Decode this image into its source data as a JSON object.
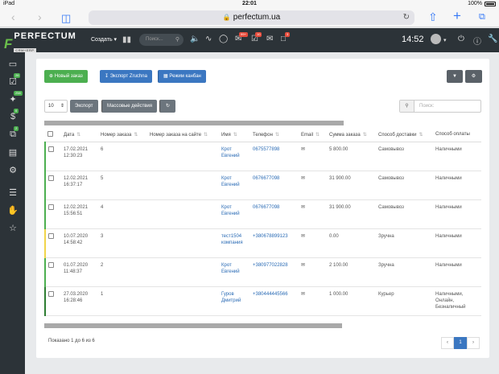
{
  "ios": {
    "device": "iPad",
    "time": "22:01",
    "battery": "100%"
  },
  "browser": {
    "url": "perfectum.ua"
  },
  "header": {
    "logo_text": "PERFECTUM",
    "logo_sub": "CRM+ERP",
    "create_label": "Создать",
    "search_placeholder": "Поиск...",
    "badges": {
      "messages": "99+",
      "tasks": "10",
      "notifications": "3"
    },
    "clock": "14:52"
  },
  "sidebar": {
    "badges": {
      "tasks": "26",
      "deals": "258",
      "finance": "6",
      "orders": "2"
    }
  },
  "toolbar": {
    "new_order": "Новый заказ",
    "export_z": "Экспорт Zruchna",
    "kanban": "Режим канбан",
    "page_size": "10",
    "export": "Экспорт",
    "bulk": "Массовые действия",
    "search_placeholder": "Поиск:"
  },
  "table": {
    "headers": [
      "Дата",
      "Номер заказа",
      "Номер заказа на сайте",
      "Имя",
      "Телефон",
      "Email",
      "Сумма заказа",
      "Способ доставки",
      "Способ оплаты"
    ],
    "rows": [
      {
        "date": "17.02.2021",
        "time": "12:30:23",
        "num": "6",
        "site": "",
        "name1": "Крот",
        "name2": "Евгений",
        "phone": "0675577898",
        "sum": "5 800.00",
        "delivery": "Самовывоз",
        "pay1": "Наличными",
        "pay2": "",
        "pay3": "",
        "accent": "#4caf50"
      },
      {
        "date": "12.02.2021",
        "time": "16:37:17",
        "num": "5",
        "site": "",
        "name1": "Крот",
        "name2": "Евгений",
        "phone": "0676677098",
        "sum": "31 900.00",
        "delivery": "Самовывоз",
        "pay1": "Наличными",
        "pay2": "",
        "pay3": "",
        "accent": "#4caf50"
      },
      {
        "date": "12.02.2021",
        "time": "15:56:51",
        "num": "4",
        "site": "",
        "name1": "Крот",
        "name2": "Евгений",
        "phone": "0676677098",
        "sum": "31 900.00",
        "delivery": "Самовывоз",
        "pay1": "Наличными",
        "pay2": "",
        "pay3": "",
        "accent": "#4caf50"
      },
      {
        "date": "10.07.2020",
        "time": "14:58:42",
        "num": "3",
        "site": "",
        "name1": "тест1504",
        "name2": "компания",
        "phone": "+380678899123",
        "sum": "0.00",
        "delivery": "Зручна",
        "pay1": "Наличными",
        "pay2": "",
        "pay3": "",
        "accent": "#f1d54a"
      },
      {
        "date": "01.07.2020",
        "time": "11:48:37",
        "num": "2",
        "site": "",
        "name1": "Крот",
        "name2": "Евгений",
        "phone": "+380977022828",
        "sum": "2 100.00",
        "delivery": "Зручна",
        "pay1": "Наличными",
        "pay2": "",
        "pay3": "",
        "accent": "#4caf50"
      },
      {
        "date": "27.03.2020",
        "time": "16:28:46",
        "num": "1",
        "site": "",
        "name1": "Гуров",
        "name2": "Дмитрий",
        "phone": "+380444445566",
        "sum": "1 000.00",
        "delivery": "Курьер",
        "pay1": "Наличными,",
        "pay2": "Онлайн,",
        "pay3": "Безналичный",
        "accent": "#2e7d32"
      }
    ]
  },
  "footer": {
    "info": "Показано 1 до 6 из 6",
    "page": "1",
    "prev": "‹",
    "next": "›"
  }
}
